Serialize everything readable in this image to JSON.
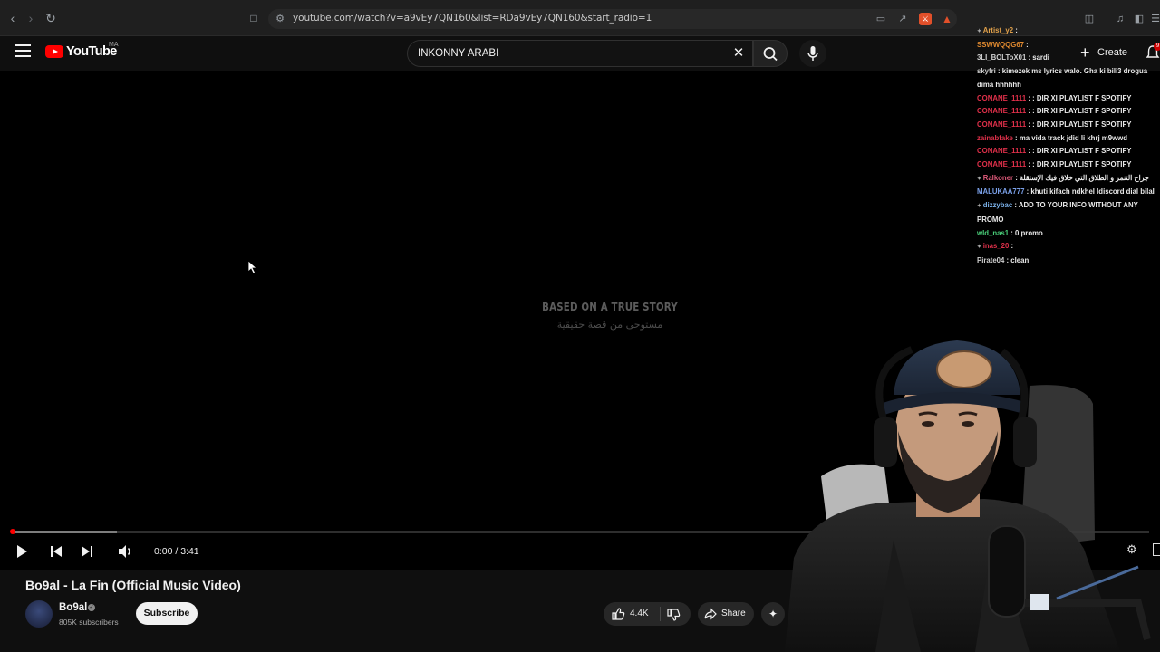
{
  "browser": {
    "url": "youtube.com/watch?v=a9vEy7QN160&list=RDa9vEy7QN160&start_radio=1"
  },
  "youtube": {
    "logo_text": "YouTube",
    "country_code": "MA",
    "search_value": "INKONNY ARABI",
    "create_label": "Create",
    "notification_count": "9"
  },
  "player": {
    "overlay_title": "BASED ON A TRUE STORY",
    "overlay_subtitle": "مستوحى من قصة حقيقية",
    "time_readout": "0:00 / 3:41",
    "buffered_fraction": 0.093,
    "played_fraction": 0.0
  },
  "chat": {
    "messages": [
      {
        "user": "Artist_y2",
        "text": "",
        "color": "#e0a04a",
        "badge": true
      },
      {
        "user": "SSWWQQG67",
        "text": "",
        "color": "#e08a30",
        "badge": false
      },
      {
        "user": "3LI_BOLToX01",
        "text": "sardi",
        "color": "#cfcfcf",
        "badge": false
      },
      {
        "user": "skyfri",
        "text": "kimezek ms lyrics walo. Gha ki bili3 drogua dima hhhhhh",
        "color": "#cfcfcf",
        "badge": false
      },
      {
        "user": "CONANE_1111",
        "text": ": DIR XI PLAYLIST F SPOTIFY",
        "color": "#e0304a",
        "badge": false
      },
      {
        "user": "CONANE_1111",
        "text": ": DIR XI PLAYLIST F SPOTIFY",
        "color": "#e0304a",
        "badge": false
      },
      {
        "user": "CONANE_1111",
        "text": ": DIR XI PLAYLIST F SPOTIFY",
        "color": "#e0304a",
        "badge": false
      },
      {
        "user": "zainabfake",
        "text": "ma vida track jdid li khrj m9wwd",
        "color": "#e0304a",
        "badge": false
      },
      {
        "user": "CONANE_1111",
        "text": ": DIR XI PLAYLIST F SPOTIFY",
        "color": "#e0304a",
        "badge": false
      },
      {
        "user": "CONANE_1111",
        "text": ": DIR XI PLAYLIST F SPOTIFY",
        "color": "#e0304a",
        "badge": false
      },
      {
        "user": "Ralkoner",
        "text": "جراح التنمر و الطلاق التي خلاق فيك الإستقلة",
        "color": "#e05a7a",
        "badge": true
      },
      {
        "user": "MALUKAA777",
        "text": "khuti kifach ndkhel ldiscord dial bilal",
        "color": "#7aa0e8",
        "badge": false
      },
      {
        "user": "dizzybac",
        "text": "ADD TO YOUR INFO WITHOUT ANY PROMO",
        "color": "#7ab0e8",
        "badge": true
      },
      {
        "user": "wld_nas1",
        "text": "0 promo",
        "color": "#4ad07a",
        "badge": false
      },
      {
        "user": "inas_20",
        "text": "",
        "color": "#e0304a",
        "badge": true
      },
      {
        "user": "Pirate04",
        "text": "clean",
        "color": "#cfcfcf",
        "badge": false
      }
    ]
  },
  "video": {
    "title": "Bo9al - La Fin (Official Music Video)",
    "channel_name": "Bo9al",
    "subscribers": "805K subscribers",
    "subscribe_label": "Subscribe",
    "like_count": "4.4K",
    "share_label": "Share"
  },
  "colors": {
    "youtube_red": "#ff0000",
    "background": "#0f0f0f"
  }
}
